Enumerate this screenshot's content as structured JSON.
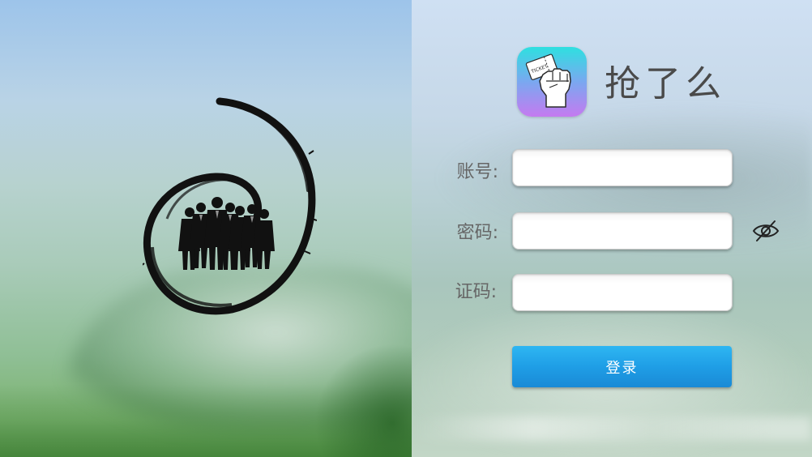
{
  "app": {
    "title": "抢了么",
    "icon_name": "raised-fist-ticket-icon",
    "icon_ticket_text": "TICKET"
  },
  "form": {
    "account_label": "账号:",
    "account_value": "",
    "password_label": "密码:",
    "password_value": "",
    "code_label": "证码:",
    "code_value": "",
    "password_visibility_icon": "eye-off-icon",
    "login_label": "登录"
  },
  "colors": {
    "login_button": "#1f9ee6",
    "app_icon_top": "#2ee0e0",
    "app_icon_bottom": "#c57af0",
    "title_text": "#4a4a4a"
  }
}
